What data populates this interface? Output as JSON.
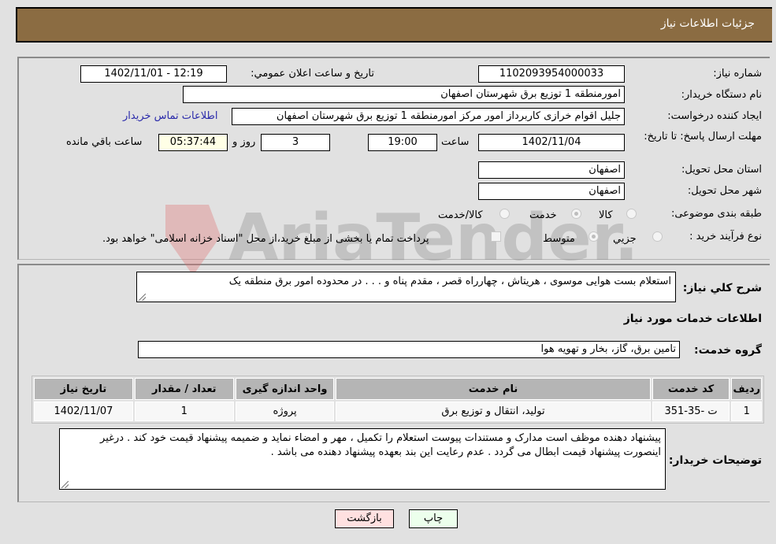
{
  "header": {
    "title": "جزئيات اطلاعات نیاز"
  },
  "form": {
    "need_number": {
      "label": "شماره نیاز:",
      "value": "1102093954000033"
    },
    "announce_datetime": {
      "label": "تاريخ و ساعت اعلان عمومي:",
      "value": "1402/11/01 - 12:19"
    },
    "buyer_org": {
      "label": "نام دستگاه خریدار:",
      "value": "امورمنطقه 1 توزیع برق شهرستان اصفهان"
    },
    "requester": {
      "label": "ایجاد کننده درخواست:",
      "value": "جلیل اقوام خرازی کاربرداز امور مرکز امورمنطقه 1 توزیع برق شهرستان اصفهان"
    },
    "buyer_contact_link": "اطلاعات تماس خریدار",
    "deadline": {
      "label": "مهلت ارسال پاسخ: تا تاریخ:",
      "date": "1402/11/04",
      "time_label": "ساعت",
      "time": "19:00",
      "days": "3",
      "days_label": "روز و",
      "remaining": "05:37:44",
      "remaining_label": "ساعت باقي مانده"
    },
    "province": {
      "label": "استان محل تحویل:",
      "value": "اصفهان"
    },
    "city": {
      "label": "شهر محل تحویل:",
      "value": "اصفهان"
    },
    "category": {
      "label": "طبقه بندی موضوعی:",
      "options": [
        "کالا",
        "خدمت",
        "کالا/خدمت"
      ],
      "selected": "خدمت"
    },
    "purchase_type": {
      "label": "نوع فرآیند خرید :",
      "options": [
        "جزيي",
        "متوسط"
      ],
      "selected": "متوسط",
      "treasury_note": "پرداخت تمام یا بخشی از مبلغ خرید،از محل \"اسناد خزانه اسلامی\" خواهد بود."
    }
  },
  "summary": {
    "label": "شرح کلي نیاز:",
    "value": "استعلام بست هوایی موسوی ، هریتاش ، چهارراه قصر ، مقدم پناه و . . . در محدوده امور برق منطقه یک"
  },
  "services": {
    "section_title": "اطلاعات خدمات مورد نیاز",
    "group_label": "گروه خدمت:",
    "group_value": "تامین برق، گاز، بخار و تهویه هوا",
    "columns": [
      "ردیف",
      "کد خدمت",
      "نام خدمت",
      "واحد اندازه گیری",
      "تعداد / مقدار",
      "تاریخ نیاز"
    ],
    "rows": [
      [
        "1",
        "ت -35-351",
        "تولید، انتقال و توزیع برق",
        "پروژه",
        "1",
        "1402/11/07"
      ]
    ]
  },
  "buyer_notes": {
    "label": "توضیحات خریدار:",
    "value": "پیشنهاد دهنده موظف است مدارک و مستندات پیوست استعلام را تکمیل ، مهر و امضاء نماید و ضمیمه پیشنهاد قیمت خود کند . درغیر اینصورت پیشنهاد قیمت ابطال می گردد . عدم رعایت این بند بعهده پیشنهاد دهنده می باشد ."
  },
  "buttons": {
    "print": "چاپ",
    "back": "بازگشت"
  },
  "watermark": "AriaTender.neT"
}
